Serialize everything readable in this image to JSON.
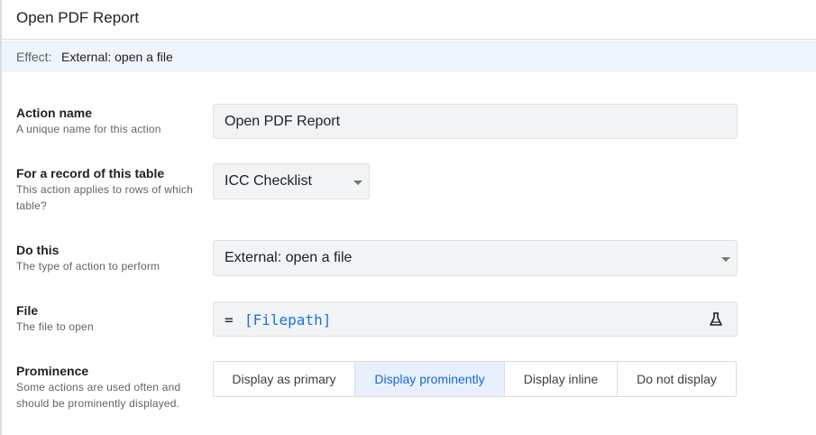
{
  "header": {
    "title": "Open PDF Report"
  },
  "effect": {
    "label": "Effect:",
    "value": "External: open a file"
  },
  "form": {
    "action_name": {
      "label": "Action name",
      "help": "A unique name for this action",
      "value": "Open PDF Report"
    },
    "table": {
      "label": "For a record of this table",
      "help": "This action applies to rows of which table?",
      "value": "ICC Checklist"
    },
    "do_this": {
      "label": "Do this",
      "help": "The type of action to perform",
      "value": "External: open a file"
    },
    "file": {
      "label": "File",
      "help": "The file to open",
      "operator": "=",
      "expression": "[Filepath]",
      "icon": "flask-icon"
    },
    "prominence": {
      "label": "Prominence",
      "help": "Some actions are used often and should be prominently displayed.",
      "options": [
        "Display as primary",
        "Display prominently",
        "Display inline",
        "Do not display"
      ],
      "selected": "Display prominently"
    }
  },
  "colors": {
    "accent": "#1967d2",
    "effect_bg": "#eef3fc",
    "field_bg": "#f1f3f4",
    "selected_bg": "#e8f0fe"
  }
}
